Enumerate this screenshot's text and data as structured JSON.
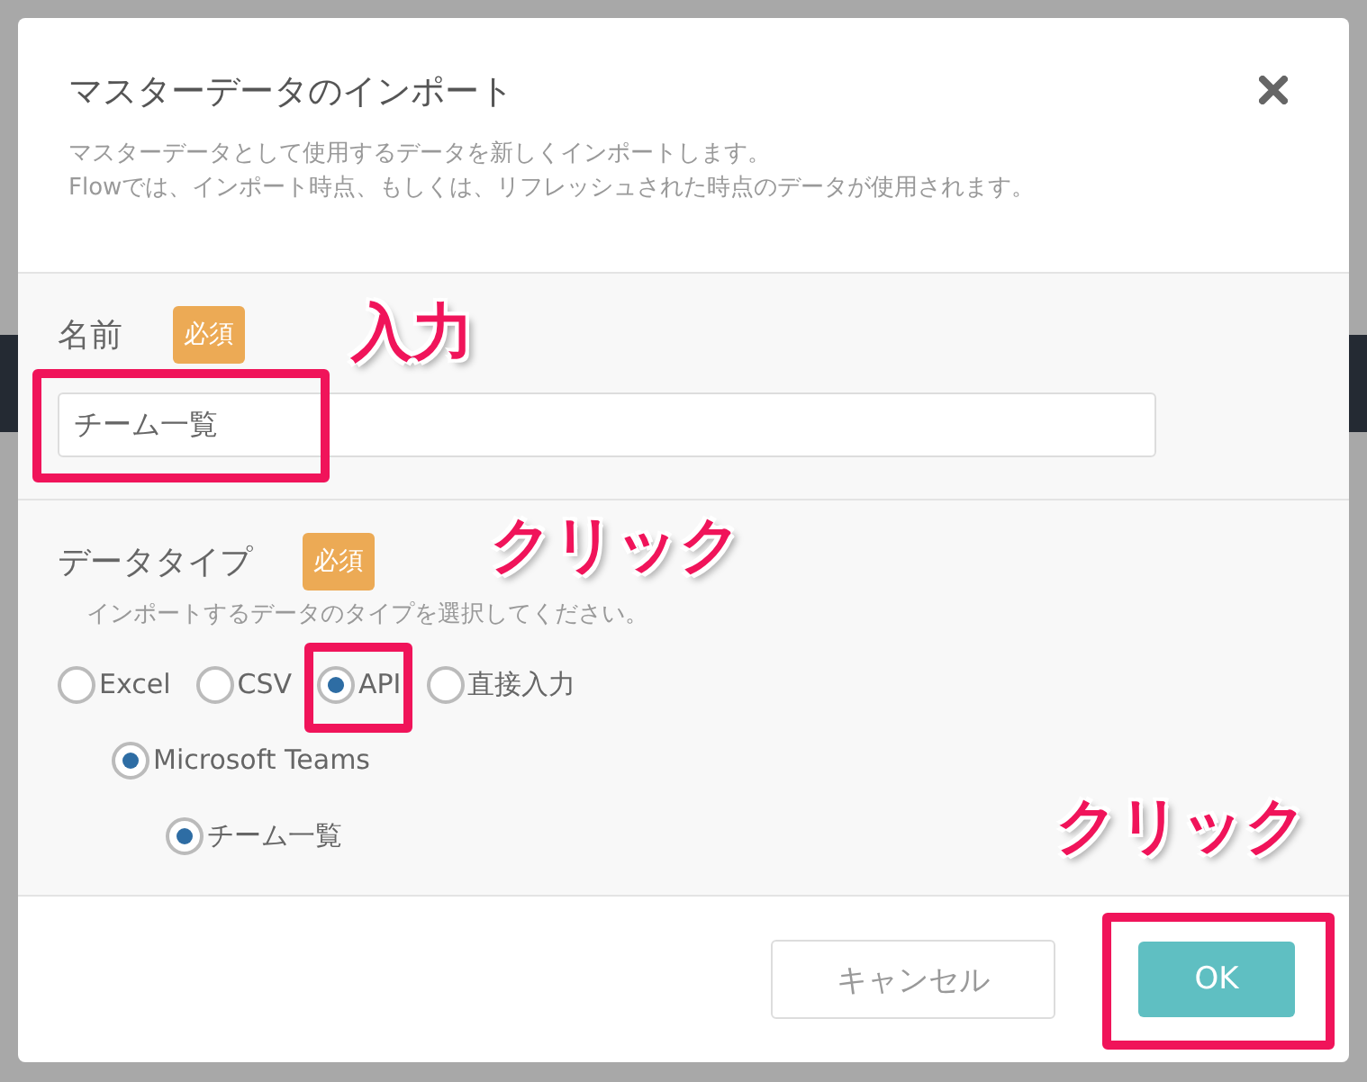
{
  "dialog": {
    "title": "マスターデータのインポート",
    "description": [
      "マスターデータとして使用するデータを新しくインポートします。",
      "Flowでは、インポート時点、もしくは、リフレッシュされた時点のデータが使用されます。"
    ]
  },
  "name_field": {
    "label": "名前",
    "badge": "必須",
    "value": "チーム一覧"
  },
  "data_type": {
    "label": "データタイプ",
    "badge": "必須",
    "hint": "インポートするデータのタイプを選択してください。",
    "options": [
      {
        "label": "Excel",
        "selected": false
      },
      {
        "label": "CSV",
        "selected": false
      },
      {
        "label": "API",
        "selected": true,
        "children": [
          {
            "label": "Microsoft Teams",
            "selected": true,
            "children": [
              {
                "label": "チーム一覧",
                "selected": true
              }
            ]
          }
        ]
      },
      {
        "label": "直接入力",
        "selected": false
      }
    ]
  },
  "buttons": [
    {
      "label": "キャンセル",
      "kind": "secondary"
    },
    {
      "label": "OK",
      "kind": "primary"
    }
  ],
  "annotations": [
    {
      "label": "入力"
    },
    {
      "label": "クリック"
    },
    {
      "label": "クリック"
    }
  ]
}
